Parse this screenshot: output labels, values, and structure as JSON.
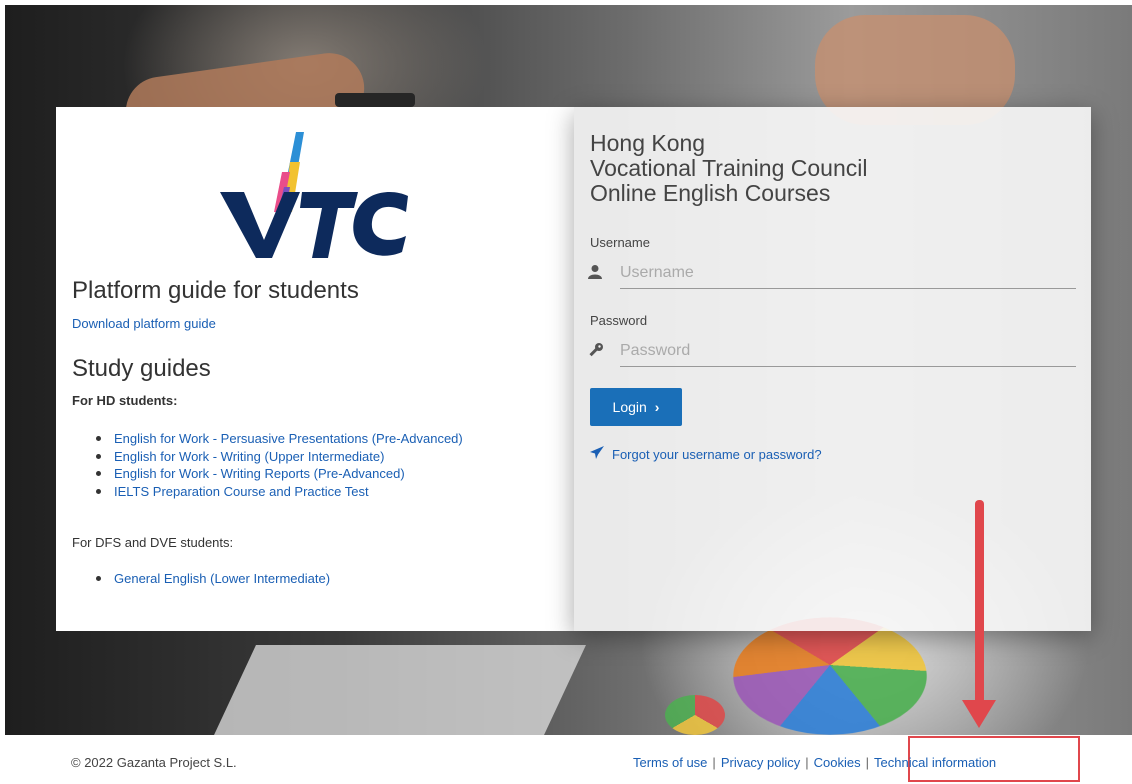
{
  "left": {
    "logo_text": "VTC",
    "platform_heading": "Platform guide for students",
    "download_link": "Download platform guide",
    "study_heading": "Study guides",
    "hd_label": "For HD students:",
    "hd_courses": [
      "English for Work - Persuasive Presentations (Pre-Advanced)",
      "English for Work - Writing (Upper Intermediate)",
      "English for Work - Writing Reports (Pre-Advanced)",
      "IELTS Preparation Course and Practice Test"
    ],
    "dfs_label": "For DFS and DVE students:",
    "dfs_courses": [
      "General English (Lower Intermediate)"
    ]
  },
  "login": {
    "title_lines": [
      "Hong Kong",
      "Vocational Training Council",
      "Online English Courses"
    ],
    "username_label": "Username",
    "username_placeholder": "Username",
    "username_icon": "user-icon",
    "password_label": "Password",
    "password_placeholder": "Password",
    "password_icon": "key-icon",
    "login_button": "Login",
    "login_icon": "chevron-right-icon",
    "forgot_link": "Forgot your username or password?",
    "forgot_icon": "paper-plane-icon"
  },
  "footer": {
    "copyright": "© 2022 Gazanta Project S.L.",
    "links": [
      "Terms of use",
      "Privacy policy",
      "Cookies",
      "Technical information"
    ]
  },
  "colors": {
    "accent": "#1a6fb8",
    "link": "#1a5fb4",
    "annotation": "#e0474c",
    "logo_navy": "#0d2a5c"
  }
}
